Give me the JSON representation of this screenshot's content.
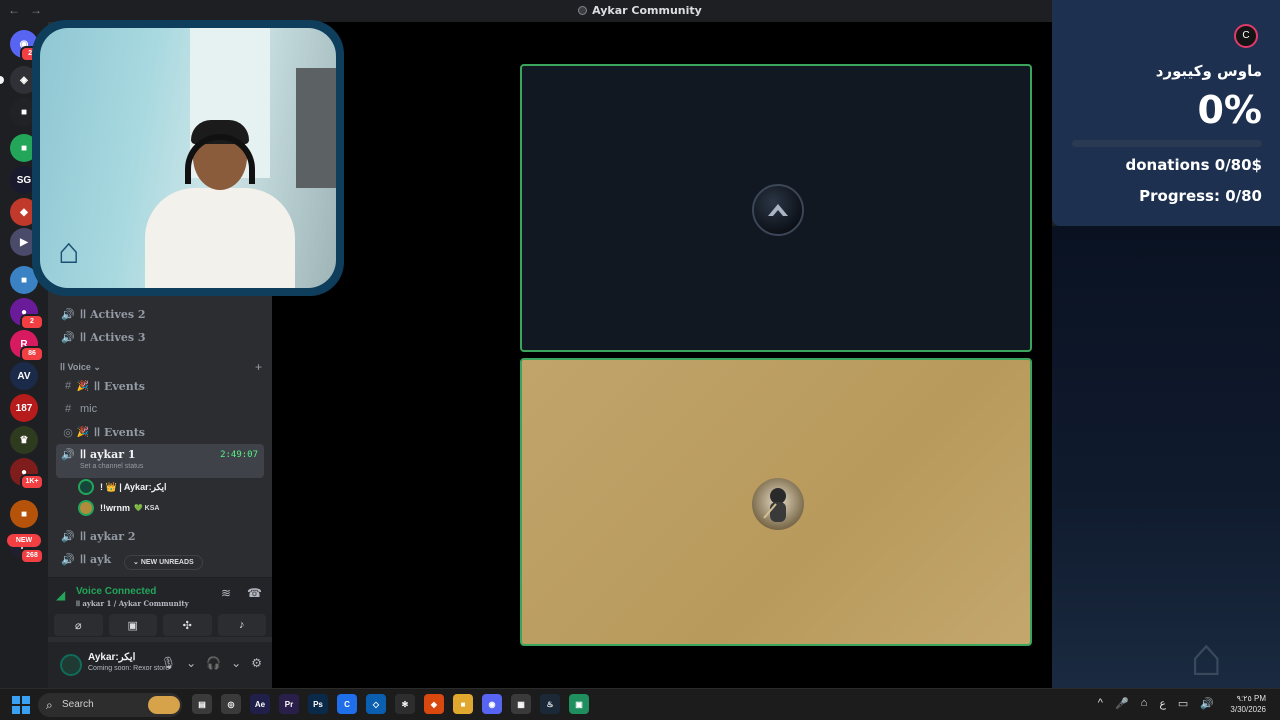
{
  "window": {
    "title": "Aykar Community",
    "nav_back": "←",
    "nav_forward": "→",
    "controls": [
      "▭",
      "?",
      "—",
      "☐",
      "✕"
    ]
  },
  "rail": {
    "servers": [
      {
        "name": "discord-home",
        "glyph": "◉",
        "color": "#5865f2",
        "badge": "21"
      },
      {
        "name": "server-1",
        "glyph": "◈",
        "color": "#2f3136",
        "badge": ""
      },
      {
        "name": "server-2",
        "glyph": "■",
        "color": "#202225",
        "badge": ""
      },
      {
        "name": "server-3",
        "glyph": "■",
        "color": "#23a55a",
        "badge": ""
      },
      {
        "name": "server-4",
        "glyph": "SG",
        "color": "#1a1a2e",
        "badge": ""
      },
      {
        "name": "server-5",
        "glyph": "◆",
        "color": "#c0392b",
        "badge": ""
      },
      {
        "name": "server-6",
        "glyph": "▶",
        "color": "#4a4a6a",
        "badge": ""
      },
      {
        "name": "folder-1",
        "glyph": "■",
        "color": "#3b82c4",
        "badge": ""
      },
      {
        "name": "server-7",
        "glyph": "●",
        "color": "#6a1b9a",
        "badge": "2"
      },
      {
        "name": "server-8",
        "glyph": "R",
        "color": "#d81b60",
        "badge": "86"
      },
      {
        "name": "server-9",
        "glyph": "AV",
        "color": "#1c2a4a",
        "badge": ""
      },
      {
        "name": "server-10",
        "glyph": "187",
        "color": "#b71c1c",
        "badge": ""
      },
      {
        "name": "server-11",
        "glyph": "♛",
        "color": "#2e3b1f",
        "badge": ""
      },
      {
        "name": "server-12",
        "glyph": "●",
        "color": "#7f1d1d",
        "badge": "1K+"
      },
      {
        "name": "folder-2",
        "glyph": "■",
        "color": "#b45309",
        "badge": ""
      },
      {
        "name": "server-13",
        "glyph": "P",
        "color": "#1f1f2e",
        "badge": "268"
      }
    ],
    "new_pill": "NEW"
  },
  "sidebar": {
    "channels": [
      {
        "icon": "🔊",
        "label": "اا Actives 2"
      },
      {
        "icon": "🔊",
        "label": "اا Actives 3"
      }
    ],
    "category": "اا Voice",
    "text_channels": [
      {
        "icon": "#",
        "label": "اا Events",
        "emoji": "🎉"
      },
      {
        "icon": "#",
        "label": "mic",
        "emoji": ""
      },
      {
        "icon": "◎",
        "label": "اا Events",
        "emoji": "🎉"
      }
    ],
    "active_channel": {
      "label": "اا aykar 1",
      "time": "2:49:07",
      "status": "Set a channel status"
    },
    "members": [
      {
        "name": "! 👑 | Aykar:ايكر",
        "tag": ""
      },
      {
        "name": "!!wrnm",
        "tag": "💚 KSA"
      }
    ],
    "more_channels": [
      {
        "label": "اا aykar 2"
      },
      {
        "label": "اا ayk"
      }
    ],
    "new_unreads": "NEW UNREADS",
    "voice": {
      "title": "Voice Connected",
      "subtitle": "اا aykar 1 / Aykar Community"
    },
    "user": {
      "name": "Aykar:ايكر",
      "status": "Coming soon: Rexor store"
    }
  },
  "goal": {
    "title": "ماوس وكيبورد",
    "percent_text": "0%",
    "progress_fraction": 0.0,
    "donations": "donations 0/80$",
    "progress": "Progress: 0/80"
  },
  "taskbar": {
    "search": "Search",
    "apps": [
      {
        "name": "file-explorer-app",
        "glyph": "▤",
        "color": "#3a3a3a"
      },
      {
        "name": "chrome-app",
        "glyph": "◎",
        "color": "#3a3a3a"
      },
      {
        "name": "after-effects-app",
        "glyph": "Ae",
        "color": "#1f1f4a"
      },
      {
        "name": "premiere-app",
        "glyph": "Pr",
        "color": "#2a1f4a"
      },
      {
        "name": "photoshop-app",
        "glyph": "Ps",
        "color": "#0b2a4a"
      },
      {
        "name": "capcut-app",
        "glyph": "C",
        "color": "#1f6feb"
      },
      {
        "name": "vscode-app",
        "glyph": "◇",
        "color": "#0b5fb0"
      },
      {
        "name": "chatgpt-app",
        "glyph": "✻",
        "color": "#2d2d2d"
      },
      {
        "name": "brave-app",
        "glyph": "◆",
        "color": "#d9480f"
      },
      {
        "name": "folder-app",
        "glyph": "■",
        "color": "#e0a82e"
      },
      {
        "name": "discord-app",
        "glyph": "◉",
        "color": "#5865f2"
      },
      {
        "name": "notepad-app",
        "glyph": "▦",
        "color": "#3a3a3a"
      },
      {
        "name": "steam-app",
        "glyph": "♨",
        "color": "#1b2838"
      },
      {
        "name": "android-app",
        "glyph": "▣",
        "color": "#1f8f5f"
      }
    ],
    "tray": [
      "^",
      "🎤",
      "⌂",
      "ع",
      "▭",
      "🔊"
    ],
    "time": "٩:٢٥ PM",
    "date": "3/30/2026"
  }
}
